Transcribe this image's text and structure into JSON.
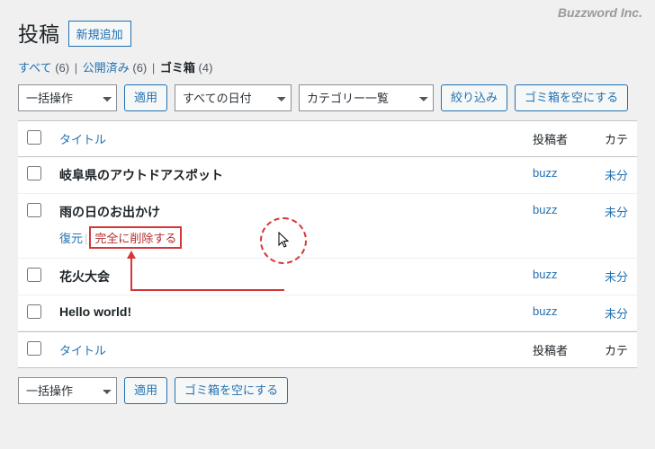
{
  "brand": "Buzzword Inc.",
  "page": {
    "title": "投稿",
    "add_new": "新規追加"
  },
  "filters": {
    "links": [
      {
        "label": "すべて",
        "count": "(6)",
        "current": false
      },
      {
        "label": "公開済み",
        "count": "(6)",
        "current": false
      },
      {
        "label": "ゴミ箱",
        "count": "(4)",
        "current": true
      }
    ]
  },
  "bulk": {
    "label": "一括操作",
    "apply": "適用"
  },
  "date_filter": {
    "label": "すべての日付"
  },
  "cat_filter": {
    "label": "カテゴリー一覧"
  },
  "filter_btn": "絞り込み",
  "empty_trash": "ゴミ箱を空にする",
  "columns": {
    "title": "タイトル",
    "author": "投稿者",
    "categories": "カテ"
  },
  "posts": [
    {
      "title": "岐阜県のアウトドアスポット",
      "author": "buzz",
      "cat": "未分"
    },
    {
      "title": "雨の日のお出かけ",
      "author": "buzz",
      "cat": "未分",
      "actions": {
        "restore": "復元",
        "delete": "完全に削除する"
      }
    },
    {
      "title": "花火大会",
      "author": "buzz",
      "cat": "未分"
    },
    {
      "title": "Hello world!",
      "author": "buzz",
      "cat": "未分"
    }
  ]
}
